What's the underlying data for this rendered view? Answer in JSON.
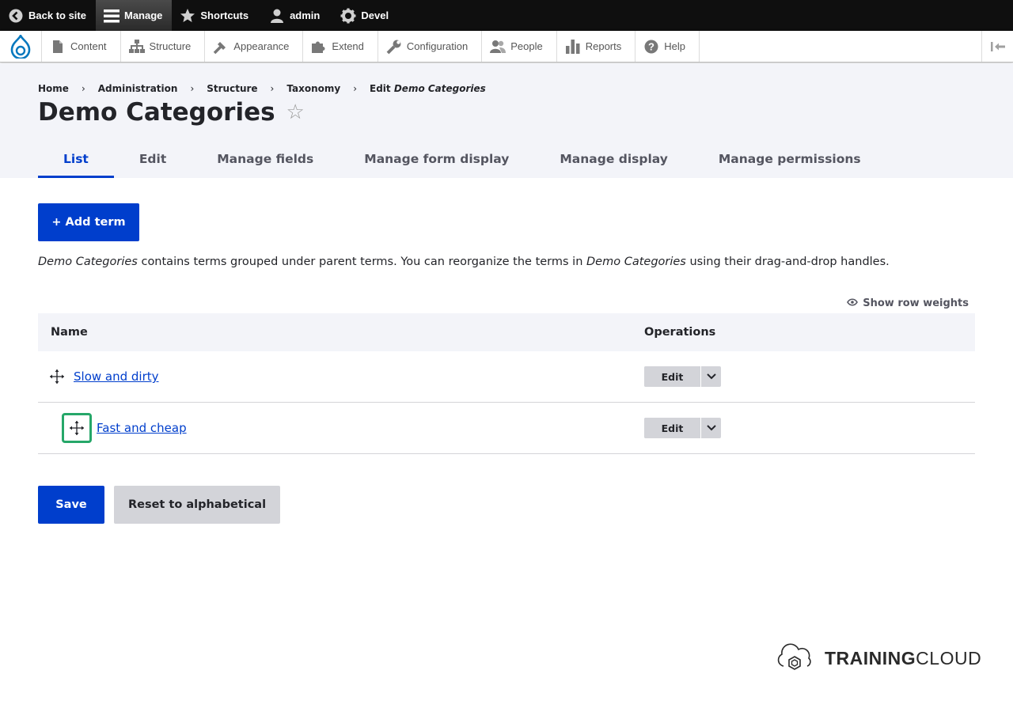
{
  "toolbar": {
    "back_to_site": "Back to site",
    "manage": "Manage",
    "shortcuts": "Shortcuts",
    "user": "admin",
    "devel": "Devel"
  },
  "tray": {
    "items": [
      "Content",
      "Structure",
      "Appearance",
      "Extend",
      "Configuration",
      "People",
      "Reports",
      "Help"
    ]
  },
  "breadcrumb": {
    "items": [
      "Home",
      "Administration",
      "Structure",
      "Taxonomy"
    ],
    "current_prefix": "Edit",
    "current_em": "Demo Categories"
  },
  "page": {
    "title": "Demo Categories",
    "star": "☆"
  },
  "tabs": [
    "List",
    "Edit",
    "Manage fields",
    "Manage form display",
    "Manage display",
    "Manage permissions"
  ],
  "main": {
    "add_term": "+ Add term",
    "help_em1": "Demo Categories",
    "help_mid": " contains terms grouped under parent terms. You can reorganize the terms in ",
    "help_em2": "Demo Categories",
    "help_end": " using their drag-and-drop handles.",
    "row_weights": "Show row weights"
  },
  "table": {
    "headers": {
      "name": "Name",
      "operations": "Operations"
    },
    "rows": [
      {
        "name": "Slow and dirty",
        "op": "Edit"
      },
      {
        "name": "Fast and cheap",
        "op": "Edit"
      }
    ]
  },
  "actions": {
    "save": "Save",
    "reset": "Reset to alphabetical"
  },
  "brand": {
    "bold": "TRAINING",
    "light": "CLOUD"
  },
  "colors": {
    "primary": "#003ecc",
    "focus": "#26a769",
    "toolbar_bg": "#0f0f0f",
    "header_bg": "#f3f4f9"
  }
}
